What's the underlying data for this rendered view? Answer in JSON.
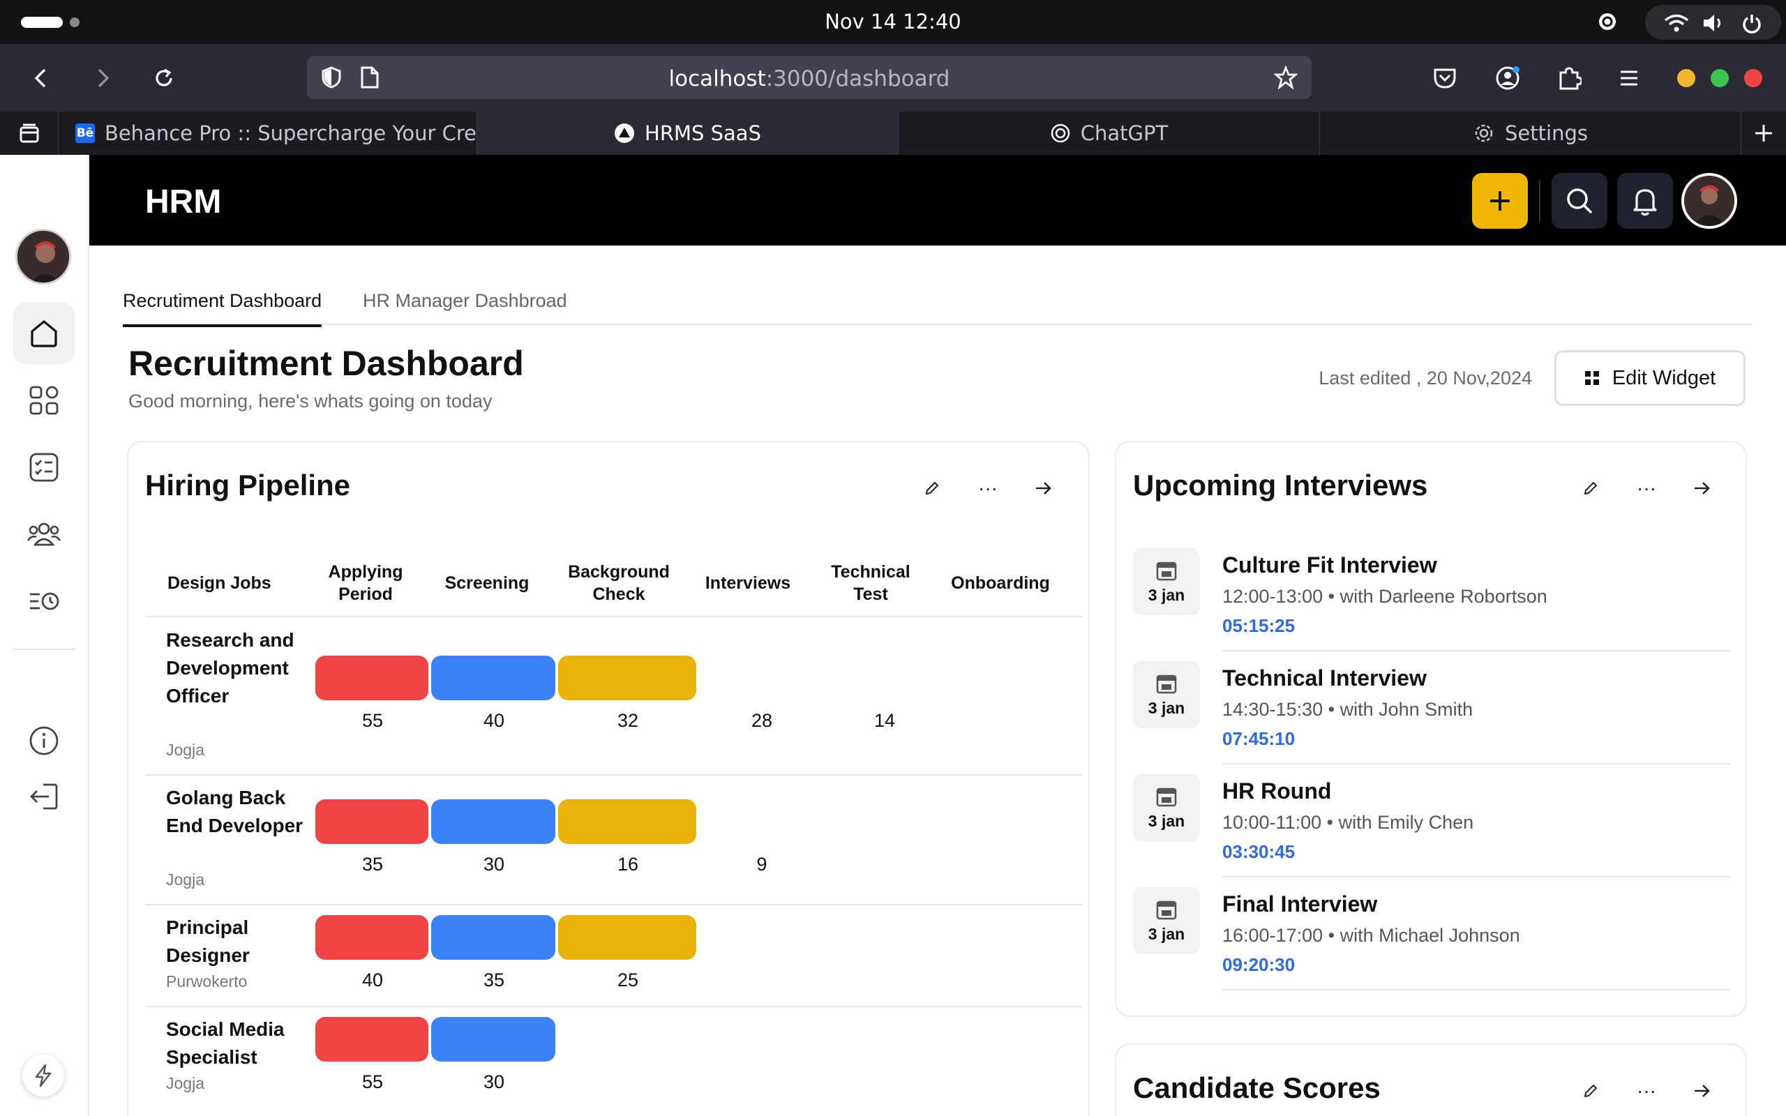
{
  "os": {
    "clock": "Nov 14  12:40"
  },
  "browser": {
    "url_host": "localhost",
    "url_path": ":3000/dashboard",
    "tabs": [
      {
        "label": "Behance Pro :: Supercharge Your Cre",
        "icon": "behance-icon"
      },
      {
        "label": "HRMS SaaS",
        "icon": "vercel-icon"
      },
      {
        "label": "ChatGPT",
        "icon": "chatgpt-icon"
      },
      {
        "label": "Settings",
        "icon": "gear-icon"
      }
    ],
    "behance_badge": "Bē"
  },
  "app": {
    "brand": "HRM",
    "accent": "#f2b705"
  },
  "page_tabs": [
    "Recrutiment Dashboard",
    "HR Manager Dashbroad"
  ],
  "page": {
    "title": "Recruitment Dashboard",
    "subtitle": "Good morning, here's whats going on today",
    "last_edited": "Last edited , 20 Nov,2024",
    "edit_widget": "Edit Widget"
  },
  "pipeline": {
    "title": "Hiring Pipeline",
    "more": "···",
    "headers": [
      "Design Jobs",
      "Applying Period",
      "Screening",
      "Background Check",
      "Interviews",
      "Technical Test",
      "Onboarding"
    ],
    "stage_colors": [
      "#ef4444",
      "#3b82f6",
      "#eab308"
    ],
    "rows": [
      {
        "title": "Research and Development Officer",
        "location": "Jogja",
        "counts": [
          "55",
          "40",
          "32",
          "28",
          "14",
          ""
        ]
      },
      {
        "title": "Golang Back End Developer",
        "location": "Jogja",
        "counts": [
          "35",
          "30",
          "16",
          "9",
          "",
          ""
        ]
      },
      {
        "title": "Principal Designer",
        "location": "Purwokerto",
        "counts": [
          "40",
          "35",
          "25",
          "",
          "",
          ""
        ]
      },
      {
        "title": "Social Media Specialist",
        "location": "Jogja",
        "counts": [
          "55",
          "30",
          "",
          "",
          "",
          ""
        ]
      }
    ]
  },
  "interviews": {
    "title": "Upcoming Interviews",
    "more": "···",
    "items": [
      {
        "date": "3 jan",
        "title": "Culture Fit Interview",
        "meta": "12:00-13:00 • with Darleene Robortson",
        "timer": "05:15:25"
      },
      {
        "date": "3 jan",
        "title": "Technical Interview",
        "meta": "14:30-15:30 • with John Smith",
        "timer": "07:45:10"
      },
      {
        "date": "3 jan",
        "title": "HR Round",
        "meta": "10:00-11:00 • with Emily Chen",
        "timer": "03:30:45"
      },
      {
        "date": "3 jan",
        "title": "Final Interview",
        "meta": "16:00-17:00 • with Michael Johnson",
        "timer": "09:20:30"
      }
    ]
  },
  "candidate_scores": {
    "title": "Candidate Scores",
    "more": "···"
  }
}
